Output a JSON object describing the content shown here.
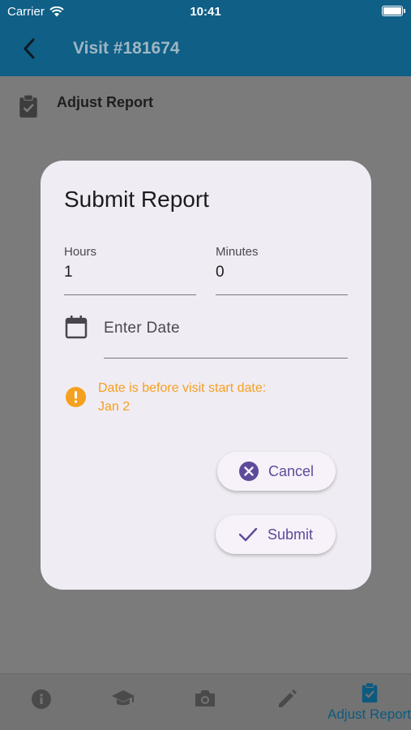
{
  "status_bar": {
    "carrier": "Carrier",
    "time": "10:41"
  },
  "app_bar": {
    "title": "Visit #181674"
  },
  "page": {
    "section_label": "Adjust Report"
  },
  "dialog": {
    "title": "Submit Report",
    "hours": {
      "label": "Hours",
      "value": "1"
    },
    "minutes": {
      "label": "Minutes",
      "value": "0"
    },
    "date": {
      "placeholder": "Enter Date"
    },
    "warning": {
      "line1": "Date is before visit start date:",
      "line2": "Jan 2"
    },
    "cancel_label": "Cancel",
    "submit_label": "Submit"
  },
  "bottom_nav": {
    "items": [
      {
        "icon": "info-icon"
      },
      {
        "icon": "graduation-cap-icon"
      },
      {
        "icon": "camera-icon"
      },
      {
        "icon": "pencil-icon"
      },
      {
        "icon": "clipboard-check-icon",
        "label": "Adjust Report",
        "active": true
      }
    ]
  },
  "colors": {
    "app_bar": "#0f5f86",
    "dialog_background": "#f0ecf3",
    "button_text": "#5d4a9a",
    "warning": "#f5a01e",
    "active_nav": "#0d5a7f"
  }
}
